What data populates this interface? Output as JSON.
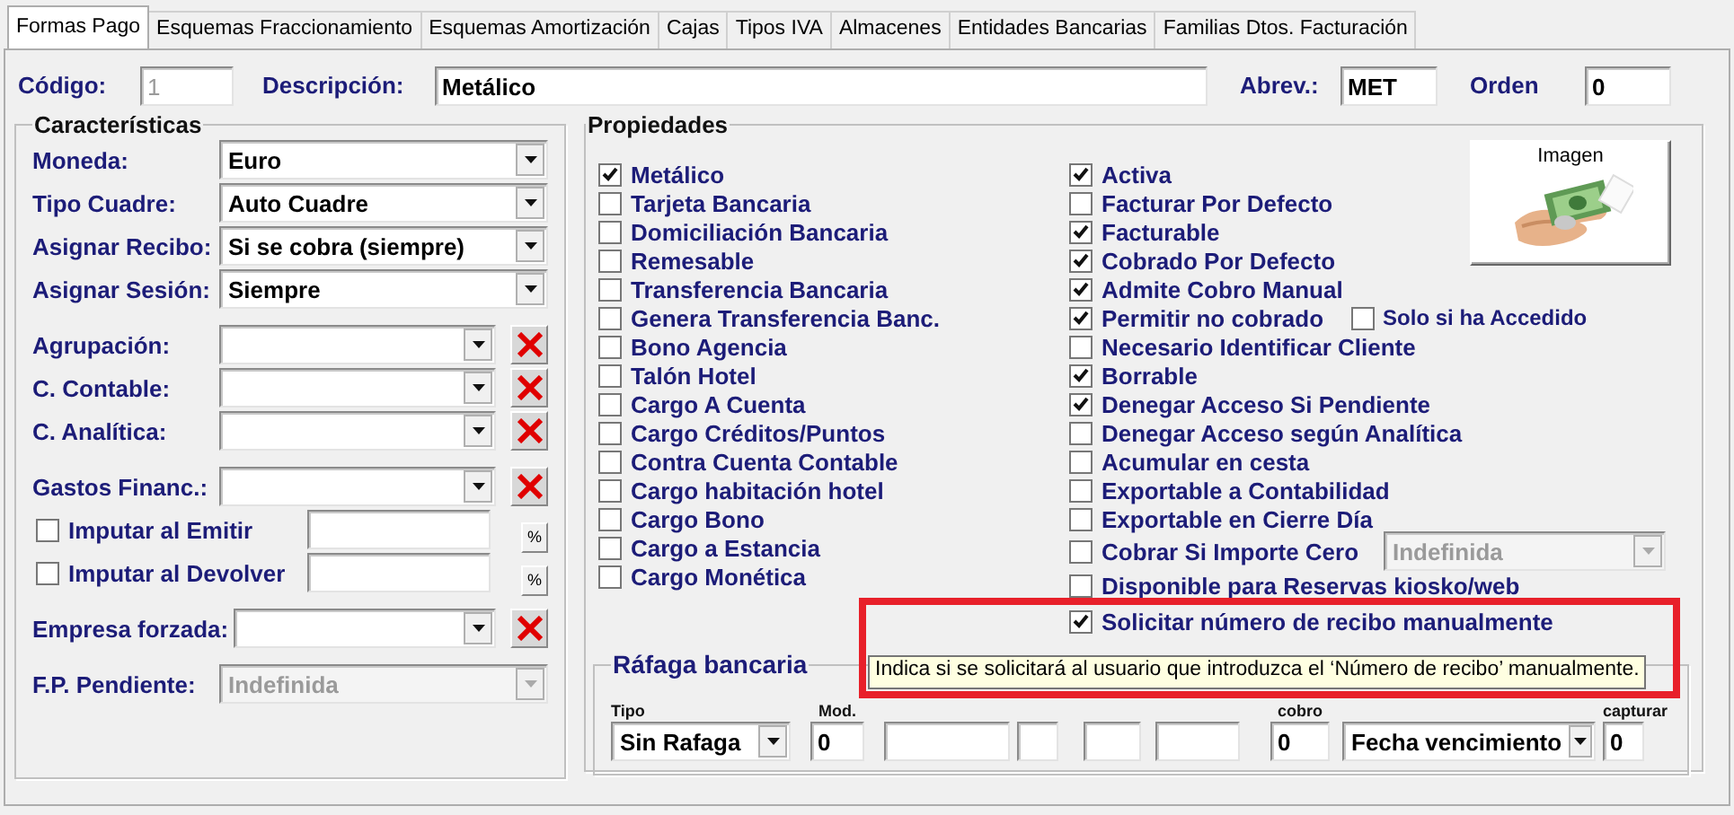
{
  "tabs": [
    {
      "label": "Formas Pago",
      "selected": true
    },
    {
      "label": "Esquemas Fraccionamiento",
      "selected": false
    },
    {
      "label": "Esquemas Amortización",
      "selected": false
    },
    {
      "label": "Cajas",
      "selected": false
    },
    {
      "label": "Tipos IVA",
      "selected": false
    },
    {
      "label": "Almacenes",
      "selected": false
    },
    {
      "label": "Entidades Bancarias",
      "selected": false
    },
    {
      "label": "Familias Dtos. Facturación",
      "selected": false
    }
  ],
  "header": [
    {
      "label": "Código:",
      "value": "1",
      "disabled": true
    },
    {
      "label": "Descripción:",
      "value": "Metálico",
      "disabled": false
    },
    {
      "label": "Abrev.:",
      "value": "MET",
      "disabled": false
    },
    {
      "label": "Orden",
      "value": "0",
      "disabled": false
    }
  ],
  "caracteristicas": {
    "title": "Características",
    "groups": [
      [
        {
          "kind": "combo",
          "label": "Moneda:",
          "value": "Euro",
          "disabled": false
        },
        {
          "kind": "combo",
          "label": "Tipo Cuadre:",
          "value": "Auto Cuadre",
          "disabled": false
        },
        {
          "kind": "combo",
          "label": "Asignar Recibo:",
          "value": "Si se cobra (siempre)",
          "disabled": false
        },
        {
          "kind": "combo",
          "label": "Asignar Sesión:",
          "value": "Siempre",
          "disabled": false
        }
      ],
      [
        {
          "kind": "combo_clear",
          "label": "Agrupación:"
        },
        {
          "kind": "combo_clear",
          "label": "C. Contable:"
        },
        {
          "kind": "combo_clear",
          "label": "C. Analítica:"
        }
      ],
      [
        {
          "kind": "combo_clear",
          "label": "Gastos Financ.:"
        },
        {
          "kind": "check_input",
          "label": "Imputar al Emitir",
          "checked": false,
          "button": "%"
        },
        {
          "kind": "check_input",
          "label": "Imputar al Devolver",
          "checked": false,
          "button": "%"
        }
      ],
      [
        {
          "kind": "combo_clear",
          "label": "Empresa forzada:"
        }
      ],
      [
        {
          "kind": "combo",
          "label": "F.P. Pendiente:",
          "value": "Indefinida",
          "disabled": true
        }
      ]
    ]
  },
  "propiedades": {
    "title": "Propiedades",
    "image_button": {
      "label": "Imagen"
    },
    "column_1": [
      {
        "label": "Metálico",
        "checked": true
      },
      {
        "label": "Tarjeta Bancaria",
        "checked": false
      },
      {
        "label": "Domiciliación Bancaria",
        "checked": false
      },
      {
        "label": "Remesable",
        "checked": false
      },
      {
        "label": "Transferencia Bancaria",
        "checked": false
      },
      {
        "label": "Genera Transferencia Banc.",
        "checked": false
      },
      {
        "label": "Bono Agencia",
        "checked": false
      },
      {
        "label": "Talón Hotel",
        "checked": false
      },
      {
        "label": "Cargo A Cuenta",
        "checked": false
      },
      {
        "label": "Cargo Créditos/Puntos",
        "checked": false
      },
      {
        "label": "Contra Cuenta Contable",
        "checked": false
      },
      {
        "label": "Cargo habitación hotel",
        "checked": false
      },
      {
        "label": "Cargo Bono",
        "checked": false
      },
      {
        "label": "Cargo a Estancia",
        "checked": false
      },
      {
        "label": "Cargo Monética",
        "checked": false
      }
    ],
    "column_2": [
      {
        "label": "Activa",
        "checked": true
      },
      {
        "label": "Facturar Por Defecto",
        "checked": false
      },
      {
        "label": "Facturable",
        "checked": true
      },
      {
        "label": "Cobrado Por Defecto",
        "checked": true
      },
      {
        "label": "Admite Cobro Manual",
        "checked": true
      },
      {
        "label": "Permitir no cobrado",
        "checked": true,
        "sub_option": {
          "label": "Solo si ha Accedido",
          "checked": false
        }
      },
      {
        "label": "Necesario Identificar Cliente",
        "checked": false
      },
      {
        "label": "Borrable",
        "checked": true
      },
      {
        "label": "Denegar Acceso Si Pendiente",
        "checked": true
      },
      {
        "label": "Denegar Acceso según Analítica",
        "checked": false
      },
      {
        "label": "Acumular en cesta",
        "checked": false
      },
      {
        "label": "Exportable a Contabilidad",
        "checked": false
      },
      {
        "label": "Exportable en Cierre Día",
        "checked": false
      },
      {
        "label": "Cobrar Si Importe Cero",
        "checked": false,
        "combo": {
          "value": "Indefinida",
          "disabled": true
        }
      },
      {
        "label": "Disponible para Reservas kiosko/web",
        "checked": false
      },
      {
        "label": "Solicitar número de recibo manualmente",
        "checked": true
      }
    ]
  },
  "rafaga": {
    "title": "Ráfaga bancaria",
    "fields": [
      {
        "kind": "combo",
        "label": "Tipo",
        "value": "Sin Rafaga"
      },
      {
        "kind": "input",
        "label": "Mod.",
        "value": "0"
      },
      {
        "kind": "input"
      },
      {
        "kind": "input"
      },
      {
        "kind": "input"
      },
      {
        "kind": "input"
      },
      {
        "kind": "input",
        "label": "cobro",
        "value": "0"
      },
      {
        "kind": "combo",
        "value": "Fecha vencimiento"
      },
      {
        "kind": "input",
        "label": "capturar",
        "value": "0"
      }
    ]
  },
  "tooltip": {
    "text": "Indica si se solicitará al usuario que introduzca el ‘Número de recibo’ manualmente."
  }
}
